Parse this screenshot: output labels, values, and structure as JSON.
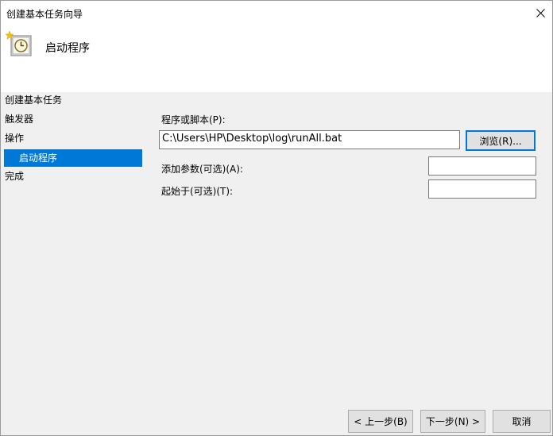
{
  "window": {
    "title": "创建基本任务向导"
  },
  "header": {
    "title": "启动程序",
    "icon": "clock-task-icon"
  },
  "sidebar": {
    "items": [
      {
        "label": "创建基本任务"
      },
      {
        "label": "触发器"
      },
      {
        "label": "操作"
      },
      {
        "label": "启动程序"
      },
      {
        "label": "完成"
      }
    ],
    "selected_color": "#0078d7"
  },
  "form": {
    "program_label": "程序或脚本(P):",
    "program_value": "C:\\Users\\HP\\Desktop\\log\\runAll.bat",
    "browse_label": "浏览(R)...",
    "args_label": "添加参数(可选)(A):",
    "args_value": "",
    "startin_label": "起始于(可选)(T):",
    "startin_value": ""
  },
  "footer": {
    "back_label": "< 上一步(B)",
    "next_label": "下一步(N) >",
    "cancel_label": "取消"
  }
}
